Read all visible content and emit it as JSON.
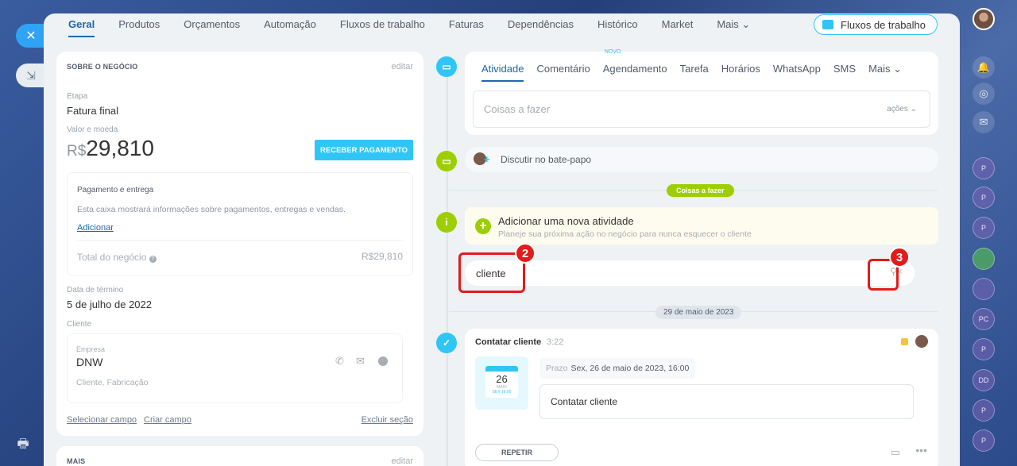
{
  "top_tabs": [
    "Geral",
    "Produtos",
    "Orçamentos",
    "Automação",
    "Fluxos de trabalho",
    "Faturas",
    "Dependências",
    "Histórico",
    "Market",
    "Mais"
  ],
  "fluxos_button": "Fluxos de trabalho",
  "about": {
    "title": "SOBRE O NEGÓCIO",
    "edit": "editar",
    "stage_label": "Etapa",
    "stage_value": "Fatura final",
    "value_label": "Valor e moeda",
    "currency": "R$",
    "amount": "29,810",
    "receive_button": "RECEBER PAGAMENTO",
    "payment_title": "Pagamento e entrega",
    "payment_desc": "Esta caixa mostrará informações sobre pagamentos, entregas e vendas.",
    "add_link": "Adicionar",
    "total_label": "Total do negócio",
    "total_value": "R$29,810",
    "end_date_label": "Data de término",
    "end_date_value": "5 de julho de 2022",
    "client_label": "Cliente",
    "company_label": "Empresa",
    "company_name": "DNW",
    "company_desc": "Cliente, Fabricação",
    "select_field": "Selecionar campo",
    "create_field": "Criar campo",
    "delete_section": "Excluir seção"
  },
  "more_section": {
    "title": "MAIS",
    "edit": "editar"
  },
  "feed_tabs": [
    "Atividade",
    "Comentário",
    "Agendamento",
    "Tarefa",
    "Horários",
    "WhatsApp",
    "SMS",
    "Mais"
  ],
  "novo_badge": "NOVO",
  "todo_placeholder": "Coisas a fazer",
  "actions_label": "ações",
  "discuss_chat": "Discutir no bate-papo",
  "todo_pill": "Coisas a fazer",
  "add_activity": {
    "title": "Adicionar uma nova atividade",
    "subtitle": "Planeje sua próxima ação no negócio para nunca esquecer o cliente"
  },
  "search": {
    "value": "cliente"
  },
  "badges": {
    "b2": "2",
    "b3": "3"
  },
  "date_pill": "29 de maio de 2023",
  "activity": {
    "title": "Contatar cliente",
    "time": "3:22",
    "cal_day": "26",
    "cal_month": "MAIO",
    "cal_sub": "SEX 16:00",
    "deadline_label": "Prazo",
    "deadline_value": "Sex, 26 de maio de 2023, 16:00",
    "note": "Contatar cliente",
    "repeat_button": "REPETIR"
  },
  "rightbar_dots": [
    "P",
    "P",
    "P",
    "",
    "",
    "PC",
    "P",
    "DD",
    "P",
    "P"
  ],
  "colors": {
    "accent": "#2fc6f6",
    "link": "#2067b0",
    "green": "#9dcf00",
    "highlight": "#e31b1b"
  }
}
